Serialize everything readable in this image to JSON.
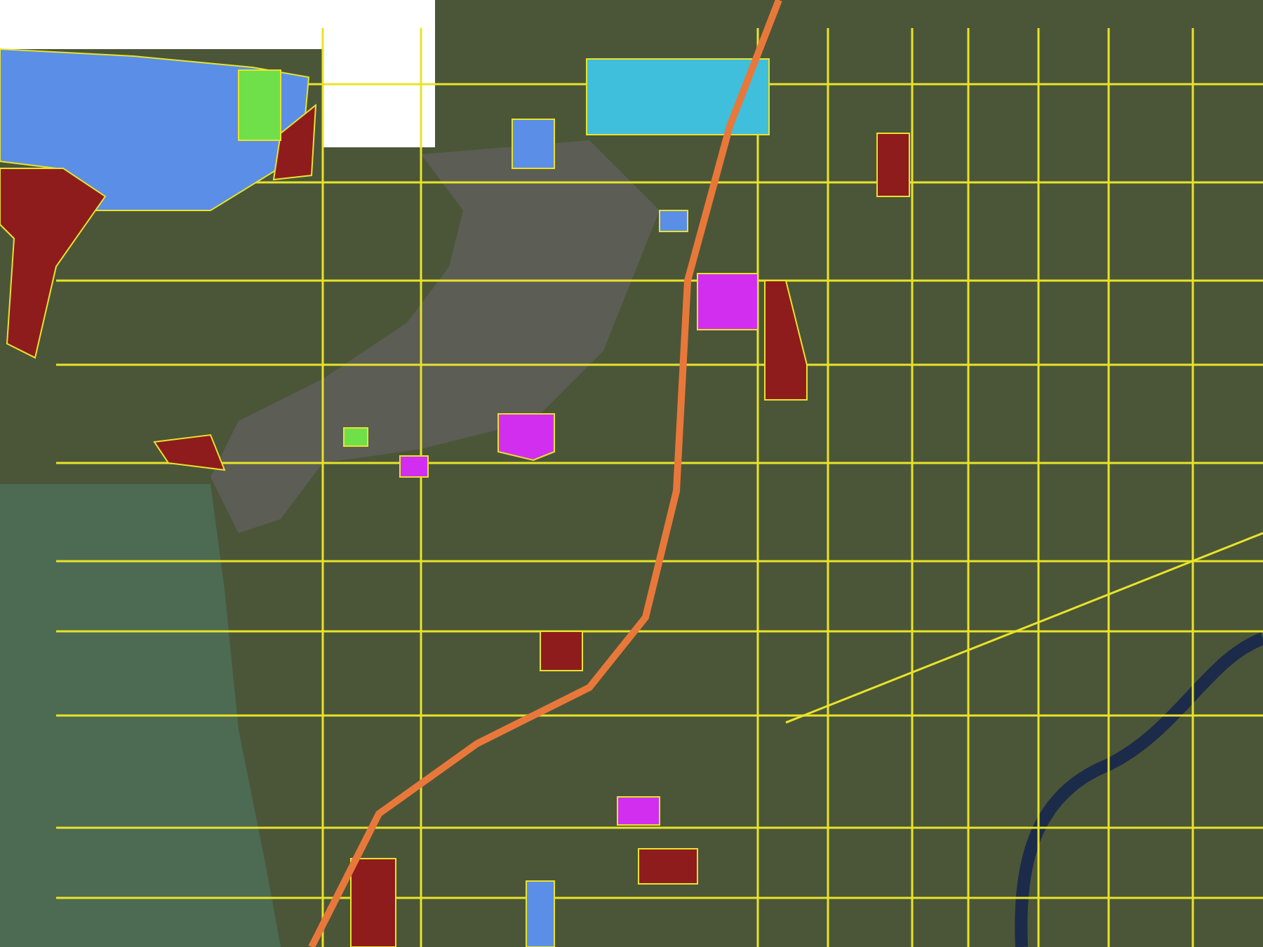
{
  "map": {
    "kind": "aerial-parcels",
    "parcel_overlays": [
      {
        "color": "#5b8ee6"
      },
      {
        "color": "#d12ef0"
      },
      {
        "color": "#8e1c1c"
      },
      {
        "color": "#6fe04a"
      },
      {
        "color": "#3fbfdc"
      }
    ]
  }
}
